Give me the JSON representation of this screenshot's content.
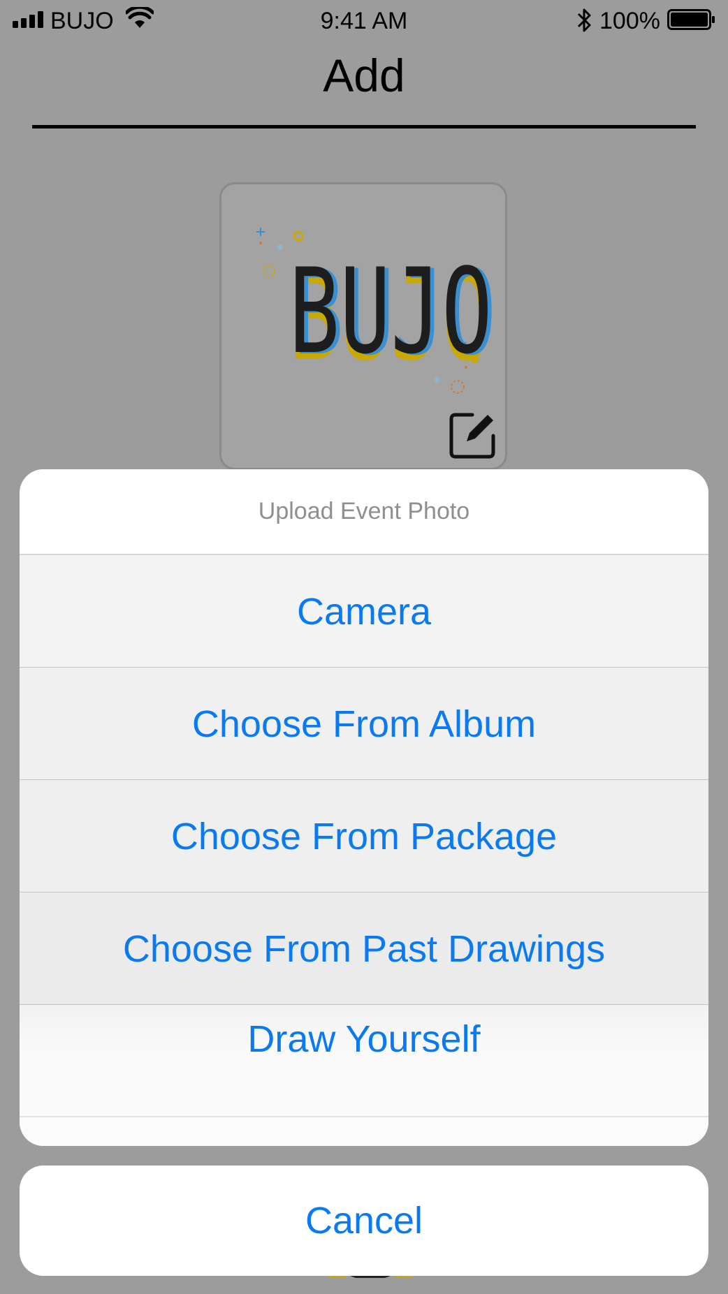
{
  "status_bar": {
    "carrier": "BUJO",
    "time": "9:41 AM",
    "battery_percent": "100%"
  },
  "nav": {
    "title": "Add"
  },
  "photo": {
    "logo_text": "BUJO"
  },
  "action_sheet": {
    "title": "Upload Event Photo",
    "actions": [
      {
        "label": "Camera"
      },
      {
        "label": "Choose From Album"
      },
      {
        "label": "Choose From Package"
      },
      {
        "label": "Choose From Past Drawings"
      },
      {
        "label": "Draw Yourself"
      }
    ],
    "cancel_label": "Cancel"
  },
  "colors": {
    "accent": "#0a7af3",
    "dim_overlay": "#9c9c9c",
    "logo_yellow": "#c9a800",
    "logo_blue": "#3a8fd0"
  }
}
